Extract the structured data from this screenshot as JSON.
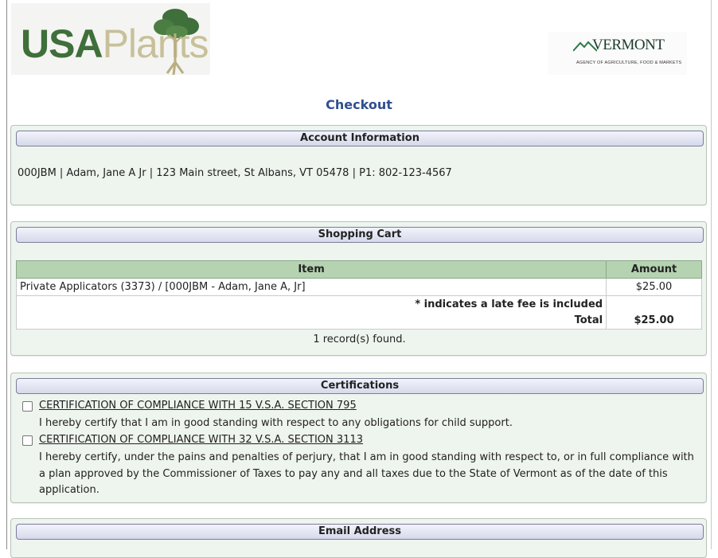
{
  "header": {
    "logo_left": {
      "part1": "USA",
      "part2": "Plants"
    },
    "logo_right": {
      "word": "VERMONT",
      "subtitle": "AGENCY OF AGRICULTURE, FOOD & MARKETS"
    }
  },
  "page_title": "Checkout",
  "account": {
    "heading": "Account Information",
    "line": "000JBM | Adam, Jane A Jr | 123 Main street, St Albans, VT 05478 | P1: 802-123-4567"
  },
  "cart": {
    "heading": "Shopping Cart",
    "columns": [
      "Item",
      "Amount"
    ],
    "rows": [
      {
        "item": "Private Applicators (3373) / [000JBM - Adam, Jane A, Jr]",
        "amount": "$25.00"
      }
    ],
    "late_fee_note": "* indicates a late fee is included",
    "total_label": "Total",
    "total_value": "$25.00",
    "records": "1 record(s) found."
  },
  "certifications": {
    "heading": "Certifications",
    "items": [
      {
        "title": "CERTIFICATION OF COMPLIANCE WITH 15 V.S.A. SECTION 795",
        "text": "I hereby certify that I am in good standing with respect to any obligations for child support.",
        "checked": false
      },
      {
        "title": "CERTIFICATION OF COMPLIANCE WITH 32 V.S.A. SECTION 3113",
        "text": "I hereby certify, under the pains and penalties of perjury, that I am in good standing with respect to, or in full compliance with a plan approved by the Commissioner of Taxes to pay any and all taxes due to the State of Vermont as of the date of this application.",
        "checked": false
      }
    ]
  },
  "email": {
    "heading": "Email Address"
  },
  "colors": {
    "panel_bg": "#eef4ee",
    "table_header": "#b5d3b1",
    "title_blue": "#2f4f8f",
    "logo_green": "#3f6f3a"
  }
}
